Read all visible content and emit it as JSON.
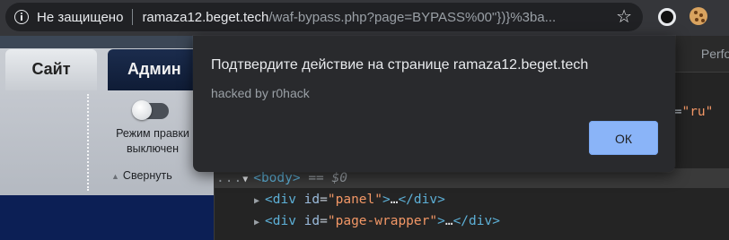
{
  "browser": {
    "security_label": "Не защищено",
    "url_host": "ramaza12.beget.tech",
    "url_rest": "/waf-bypass.php?page=BYPASS%00\"})}%3ba...",
    "icons": [
      "info-icon",
      "star-icon",
      "extension-circle-icon",
      "extension-cookie-icon"
    ]
  },
  "page": {
    "tab_site": "Сайт",
    "tab_admin": "Админ",
    "edit_mode_label": "Режим правки",
    "edit_mode_state": "выключен",
    "collapse_label": "Свернуть",
    "collapse_icon": "▲",
    "toggle_on": false
  },
  "devtools": {
    "tab_partial": "Perfor",
    "attr_fragment": {
      "tail": "g",
      "eq": "=",
      "value": "\"ru\""
    },
    "selected_line": {
      "menu": "...",
      "arrow": "▼",
      "open": "<",
      "tag": "body",
      "close": ">",
      "suffix": "== $0"
    },
    "nodes": [
      {
        "arrow": "▶",
        "open": "<",
        "tag": "div",
        "attr": "id",
        "eq": "=",
        "value": "\"panel\"",
        "close": ">",
        "ellipsis": "…",
        "end": "</div>"
      },
      {
        "arrow": "▶",
        "open": "<",
        "tag": "div",
        "attr": "id",
        "eq": "=",
        "value": "\"page-wrapper\"",
        "close": ">",
        "ellipsis": "…",
        "end": "</div>"
      }
    ]
  },
  "dialog": {
    "title": "Подтвердите действие на странице ramaza12.beget.tech",
    "message": "hacked by r0hack",
    "ok_label": "ОК"
  },
  "colors": {
    "dialog_bg": "#292a2d",
    "ok_button": "#8ab4f8",
    "tag": "#5db0d7",
    "attr_value": "#f29766"
  }
}
